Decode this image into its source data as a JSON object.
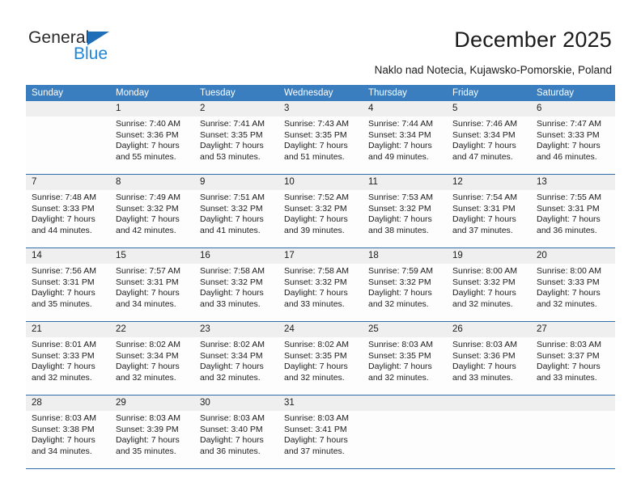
{
  "brand": {
    "name_primary": "General",
    "name_secondary": "Blue",
    "triangle_color": "#1f6fb8",
    "secondary_color": "#1f86d8"
  },
  "header": {
    "title": "December 2025",
    "subtitle": "Naklo nad Notecia, Kujawsko-Pomorskie, Poland"
  },
  "calendar": {
    "header_bg": "#3a7ebf",
    "row_rule_color": "#2f6ea8",
    "number_band_bg": "#efefef",
    "weekdays": [
      "Sunday",
      "Monday",
      "Tuesday",
      "Wednesday",
      "Thursday",
      "Friday",
      "Saturday"
    ],
    "weeks": [
      [
        {
          "day": "",
          "sunrise": "",
          "sunset": "",
          "daylight": "",
          "daylight2": ""
        },
        {
          "day": "1",
          "sunrise": "Sunrise: 7:40 AM",
          "sunset": "Sunset: 3:36 PM",
          "daylight": "Daylight: 7 hours",
          "daylight2": "and 55 minutes."
        },
        {
          "day": "2",
          "sunrise": "Sunrise: 7:41 AM",
          "sunset": "Sunset: 3:35 PM",
          "daylight": "Daylight: 7 hours",
          "daylight2": "and 53 minutes."
        },
        {
          "day": "3",
          "sunrise": "Sunrise: 7:43 AM",
          "sunset": "Sunset: 3:35 PM",
          "daylight": "Daylight: 7 hours",
          "daylight2": "and 51 minutes."
        },
        {
          "day": "4",
          "sunrise": "Sunrise: 7:44 AM",
          "sunset": "Sunset: 3:34 PM",
          "daylight": "Daylight: 7 hours",
          "daylight2": "and 49 minutes."
        },
        {
          "day": "5",
          "sunrise": "Sunrise: 7:46 AM",
          "sunset": "Sunset: 3:34 PM",
          "daylight": "Daylight: 7 hours",
          "daylight2": "and 47 minutes."
        },
        {
          "day": "6",
          "sunrise": "Sunrise: 7:47 AM",
          "sunset": "Sunset: 3:33 PM",
          "daylight": "Daylight: 7 hours",
          "daylight2": "and 46 minutes."
        }
      ],
      [
        {
          "day": "7",
          "sunrise": "Sunrise: 7:48 AM",
          "sunset": "Sunset: 3:33 PM",
          "daylight": "Daylight: 7 hours",
          "daylight2": "and 44 minutes."
        },
        {
          "day": "8",
          "sunrise": "Sunrise: 7:49 AM",
          "sunset": "Sunset: 3:32 PM",
          "daylight": "Daylight: 7 hours",
          "daylight2": "and 42 minutes."
        },
        {
          "day": "9",
          "sunrise": "Sunrise: 7:51 AM",
          "sunset": "Sunset: 3:32 PM",
          "daylight": "Daylight: 7 hours",
          "daylight2": "and 41 minutes."
        },
        {
          "day": "10",
          "sunrise": "Sunrise: 7:52 AM",
          "sunset": "Sunset: 3:32 PM",
          "daylight": "Daylight: 7 hours",
          "daylight2": "and 39 minutes."
        },
        {
          "day": "11",
          "sunrise": "Sunrise: 7:53 AM",
          "sunset": "Sunset: 3:32 PM",
          "daylight": "Daylight: 7 hours",
          "daylight2": "and 38 minutes."
        },
        {
          "day": "12",
          "sunrise": "Sunrise: 7:54 AM",
          "sunset": "Sunset: 3:31 PM",
          "daylight": "Daylight: 7 hours",
          "daylight2": "and 37 minutes."
        },
        {
          "day": "13",
          "sunrise": "Sunrise: 7:55 AM",
          "sunset": "Sunset: 3:31 PM",
          "daylight": "Daylight: 7 hours",
          "daylight2": "and 36 minutes."
        }
      ],
      [
        {
          "day": "14",
          "sunrise": "Sunrise: 7:56 AM",
          "sunset": "Sunset: 3:31 PM",
          "daylight": "Daylight: 7 hours",
          "daylight2": "and 35 minutes."
        },
        {
          "day": "15",
          "sunrise": "Sunrise: 7:57 AM",
          "sunset": "Sunset: 3:31 PM",
          "daylight": "Daylight: 7 hours",
          "daylight2": "and 34 minutes."
        },
        {
          "day": "16",
          "sunrise": "Sunrise: 7:58 AM",
          "sunset": "Sunset: 3:32 PM",
          "daylight": "Daylight: 7 hours",
          "daylight2": "and 33 minutes."
        },
        {
          "day": "17",
          "sunrise": "Sunrise: 7:58 AM",
          "sunset": "Sunset: 3:32 PM",
          "daylight": "Daylight: 7 hours",
          "daylight2": "and 33 minutes."
        },
        {
          "day": "18",
          "sunrise": "Sunrise: 7:59 AM",
          "sunset": "Sunset: 3:32 PM",
          "daylight": "Daylight: 7 hours",
          "daylight2": "and 32 minutes."
        },
        {
          "day": "19",
          "sunrise": "Sunrise: 8:00 AM",
          "sunset": "Sunset: 3:32 PM",
          "daylight": "Daylight: 7 hours",
          "daylight2": "and 32 minutes."
        },
        {
          "day": "20",
          "sunrise": "Sunrise: 8:00 AM",
          "sunset": "Sunset: 3:33 PM",
          "daylight": "Daylight: 7 hours",
          "daylight2": "and 32 minutes."
        }
      ],
      [
        {
          "day": "21",
          "sunrise": "Sunrise: 8:01 AM",
          "sunset": "Sunset: 3:33 PM",
          "daylight": "Daylight: 7 hours",
          "daylight2": "and 32 minutes."
        },
        {
          "day": "22",
          "sunrise": "Sunrise: 8:02 AM",
          "sunset": "Sunset: 3:34 PM",
          "daylight": "Daylight: 7 hours",
          "daylight2": "and 32 minutes."
        },
        {
          "day": "23",
          "sunrise": "Sunrise: 8:02 AM",
          "sunset": "Sunset: 3:34 PM",
          "daylight": "Daylight: 7 hours",
          "daylight2": "and 32 minutes."
        },
        {
          "day": "24",
          "sunrise": "Sunrise: 8:02 AM",
          "sunset": "Sunset: 3:35 PM",
          "daylight": "Daylight: 7 hours",
          "daylight2": "and 32 minutes."
        },
        {
          "day": "25",
          "sunrise": "Sunrise: 8:03 AM",
          "sunset": "Sunset: 3:35 PM",
          "daylight": "Daylight: 7 hours",
          "daylight2": "and 32 minutes."
        },
        {
          "day": "26",
          "sunrise": "Sunrise: 8:03 AM",
          "sunset": "Sunset: 3:36 PM",
          "daylight": "Daylight: 7 hours",
          "daylight2": "and 33 minutes."
        },
        {
          "day": "27",
          "sunrise": "Sunrise: 8:03 AM",
          "sunset": "Sunset: 3:37 PM",
          "daylight": "Daylight: 7 hours",
          "daylight2": "and 33 minutes."
        }
      ],
      [
        {
          "day": "28",
          "sunrise": "Sunrise: 8:03 AM",
          "sunset": "Sunset: 3:38 PM",
          "daylight": "Daylight: 7 hours",
          "daylight2": "and 34 minutes."
        },
        {
          "day": "29",
          "sunrise": "Sunrise: 8:03 AM",
          "sunset": "Sunset: 3:39 PM",
          "daylight": "Daylight: 7 hours",
          "daylight2": "and 35 minutes."
        },
        {
          "day": "30",
          "sunrise": "Sunrise: 8:03 AM",
          "sunset": "Sunset: 3:40 PM",
          "daylight": "Daylight: 7 hours",
          "daylight2": "and 36 minutes."
        },
        {
          "day": "31",
          "sunrise": "Sunrise: 8:03 AM",
          "sunset": "Sunset: 3:41 PM",
          "daylight": "Daylight: 7 hours",
          "daylight2": "and 37 minutes."
        },
        {
          "day": "",
          "sunrise": "",
          "sunset": "",
          "daylight": "",
          "daylight2": ""
        },
        {
          "day": "",
          "sunrise": "",
          "sunset": "",
          "daylight": "",
          "daylight2": ""
        },
        {
          "day": "",
          "sunrise": "",
          "sunset": "",
          "daylight": "",
          "daylight2": ""
        }
      ]
    ]
  }
}
